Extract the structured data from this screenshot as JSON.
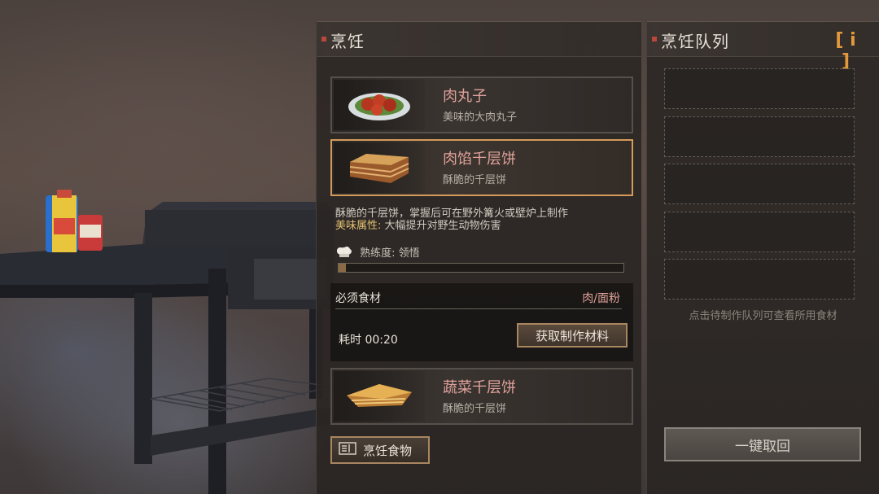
{
  "cooking_panel": {
    "title": "烹饪",
    "recipes": [
      {
        "name": "肉丸子",
        "desc": "美味的大肉丸子",
        "icon": "meatball-plate-icon"
      },
      {
        "name": "肉馅千层饼",
        "desc": "酥脆的千层饼",
        "icon": "layered-pie-icon"
      },
      {
        "name": "蔬菜千层饼",
        "desc": "酥脆的千层饼",
        "icon": "veggie-pie-icon"
      }
    ],
    "detail": {
      "description": "酥脆的千层饼，掌握后可在野外篝火或壁炉上制作",
      "attr_label": "美味属性:",
      "attr_value": " 大幅提升对野生动物伤害",
      "proficiency_text": "熟练度: 领悟",
      "proficiency_fraction": 0.025
    },
    "ingredients": {
      "label": "必须食材",
      "value": "肉/面粉",
      "time_text": "耗时 00:20",
      "get_materials_label": "获取制作材料"
    },
    "cook_button_label": "烹饪食物"
  },
  "queue_panel": {
    "title": "烹饪队列",
    "info_label": "[ i ]",
    "slot_count": 5,
    "hint": "点击待制作队列可查看所用食材",
    "recall_label": "一键取回"
  },
  "colors": {
    "accent_orange": "#e49a3c",
    "selected_border": "#d49a5c",
    "recipe_name": "#e0a29b",
    "attr_label": "#e3c072",
    "header_marker": "#b9473a"
  }
}
